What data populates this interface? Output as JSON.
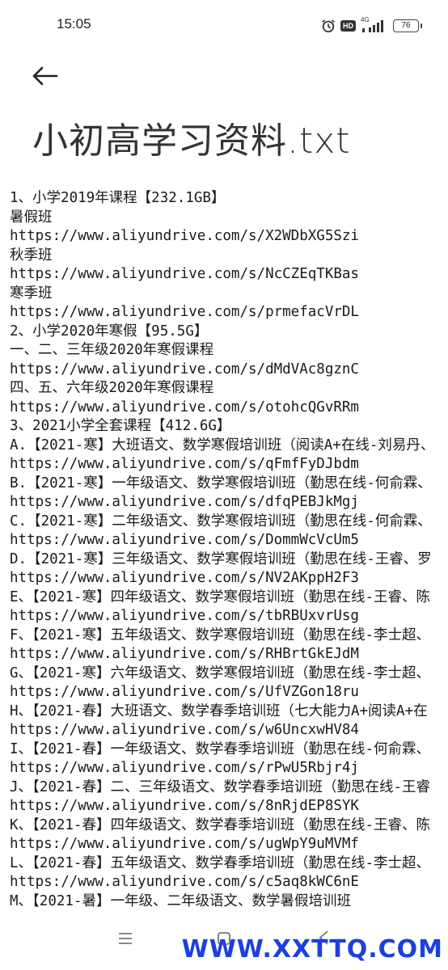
{
  "status_bar": {
    "time": "15:05",
    "network": "4G",
    "hd_label": "HD",
    "battery": "76",
    "icons": [
      "alarm-icon",
      "hd-icon",
      "signal-icon",
      "battery-icon"
    ]
  },
  "header": {
    "back_icon": "back-arrow-icon",
    "title": "小初高学习资料.txt"
  },
  "content": {
    "lines": [
      "1、小学2019年课程【232.1GB】",
      "暑假班",
      "https://www.aliyundrive.com/s/X2WDbXG5Szi",
      "秋季班",
      "https://www.aliyundrive.com/s/NcCZEqTKBas",
      "寒季班",
      "https://www.aliyundrive.com/s/prmefacVrDL",
      "2、小学2020年寒假【95.5G】",
      "一、二、三年级2020年寒假课程",
      "https://www.aliyundrive.com/s/dMdVAc8gznC",
      "四、五、六年级2020年寒假课程",
      "https://www.aliyundrive.com/s/otohcQGvRRm",
      "3、2021小学全套课程【412.6G】",
      "A.【2021-寒】大班语文、数学寒假培训班（阅读A+在线-刘易丹、",
      "https://www.aliyundrive.com/s/qFmfFyDJbdm",
      "B.【2021-寒】一年级语文、数学寒假培训班（勤思在线-何俞霖、",
      "https://www.aliyundrive.com/s/dfqPEBJkMgj",
      "C.【2021-寒】二年级语文、数学寒假培训班（勤思在线-何俞霖、",
      "https://www.aliyundrive.com/s/DommWcVcUm5",
      "D.【2021-寒】三年级语文、数学寒假培训班（勤思在线-王睿、罗",
      "https://www.aliyundrive.com/s/NV2AKppH2F3",
      "E、【2021-寒】四年级语文、数学寒假培训班（勤思在线-王睿、陈",
      "https://www.aliyundrive.com/s/tbRBUxvrUsg",
      "F、【2021-寒】五年级语文、数学寒假培训班（勤思在线-李士超、",
      "https://www.aliyundrive.com/s/RHBrtGkEJdM",
      "G、【2021-寒】六年级语文、数学寒假培训班（勤思在线-李士超、",
      "https://www.aliyundrive.com/s/UfVZGon18ru",
      "H、【2021-春】大班语文、数学春季培训班（七大能力A+阅读A+在",
      "https://www.aliyundrive.com/s/w6UncxwHV84",
      "I、【2021-春】一年级语文、数学春季培训班（勤思在线-何俞霖、",
      "https://www.aliyundrive.com/s/rPwU5Rbjr4j",
      "J、【2021-春】二、三年级语文、数学春季培训班（勤思在线-王睿",
      "https://www.aliyundrive.com/s/8nRjdEP8SYK",
      "K、【2021-春】四年级语文、数学春季培训班（勤思在线-王睿、陈",
      "https://www.aliyundrive.com/s/ugWpY9uMVMf",
      "L、【2021-春】五年级语文、数学春季培训班（勤思在线-李士超、",
      "https://www.aliyundrive.com/s/c5aq8kWC6nE",
      "M、【2021-暑】一年级、二年级语文、数学暑假培训班"
    ]
  },
  "nav_bar": {
    "icons": [
      "menu-icon",
      "home-icon",
      "back-icon"
    ]
  },
  "watermark": "WWW.XXTTQ.COM"
}
